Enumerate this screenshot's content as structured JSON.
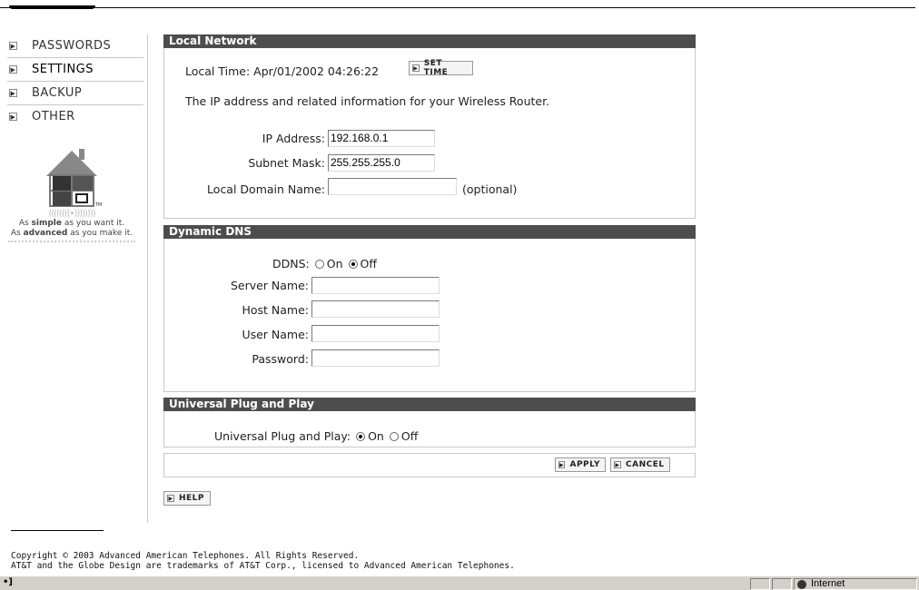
{
  "nav": {
    "items": [
      {
        "label": "PASSWORDS"
      },
      {
        "label": "SETTINGS"
      },
      {
        "label": "BACKUP"
      },
      {
        "label": "OTHER"
      }
    ]
  },
  "logo": {
    "tagline_1_pre": "As ",
    "tagline_1_bold": "simple",
    "tagline_1_post": " as you want it.",
    "tagline_2_pre": "As ",
    "tagline_2_bold": "advanced",
    "tagline_2_post": " as you make it.",
    "tm": "TM"
  },
  "local_network": {
    "title": "Local Network",
    "local_time_label": "Local Time: Apr/01/2002 04:26:22",
    "set_time_label": "SET TIME",
    "description": "The IP address and related information for your Wireless Router.",
    "ip_label": "IP Address:",
    "ip_value": "192.168.0.1",
    "mask_label": "Subnet Mask:",
    "mask_value": "255.255.255.0",
    "domain_label": "Local Domain Name:",
    "domain_value": "",
    "domain_hint": "(optional)"
  },
  "ddns": {
    "title": "Dynamic DNS",
    "ddns_label": "DDNS:",
    "on_label": "On",
    "off_label": "Off",
    "selected": "off",
    "server_label": "Server Name:",
    "host_label": "Host Name:",
    "user_label": "User Name:",
    "password_label": "Password:"
  },
  "upnp": {
    "title": "Universal Plug and Play",
    "label": "Universal Plug and Play:",
    "on_label": "On",
    "off_label": "Off",
    "selected": "on"
  },
  "actions": {
    "apply_label": "APPLY",
    "cancel_label": "CANCEL",
    "help_label": "HELP"
  },
  "footer": {
    "line1": "Copyright © 2003 Advanced American Telephones. All Rights Reserved.",
    "line2": "AT&T and the Globe Design are trademarks of AT&T Corp., licensed to Advanced American Telephones."
  },
  "statusbar": {
    "zone": "Internet"
  }
}
